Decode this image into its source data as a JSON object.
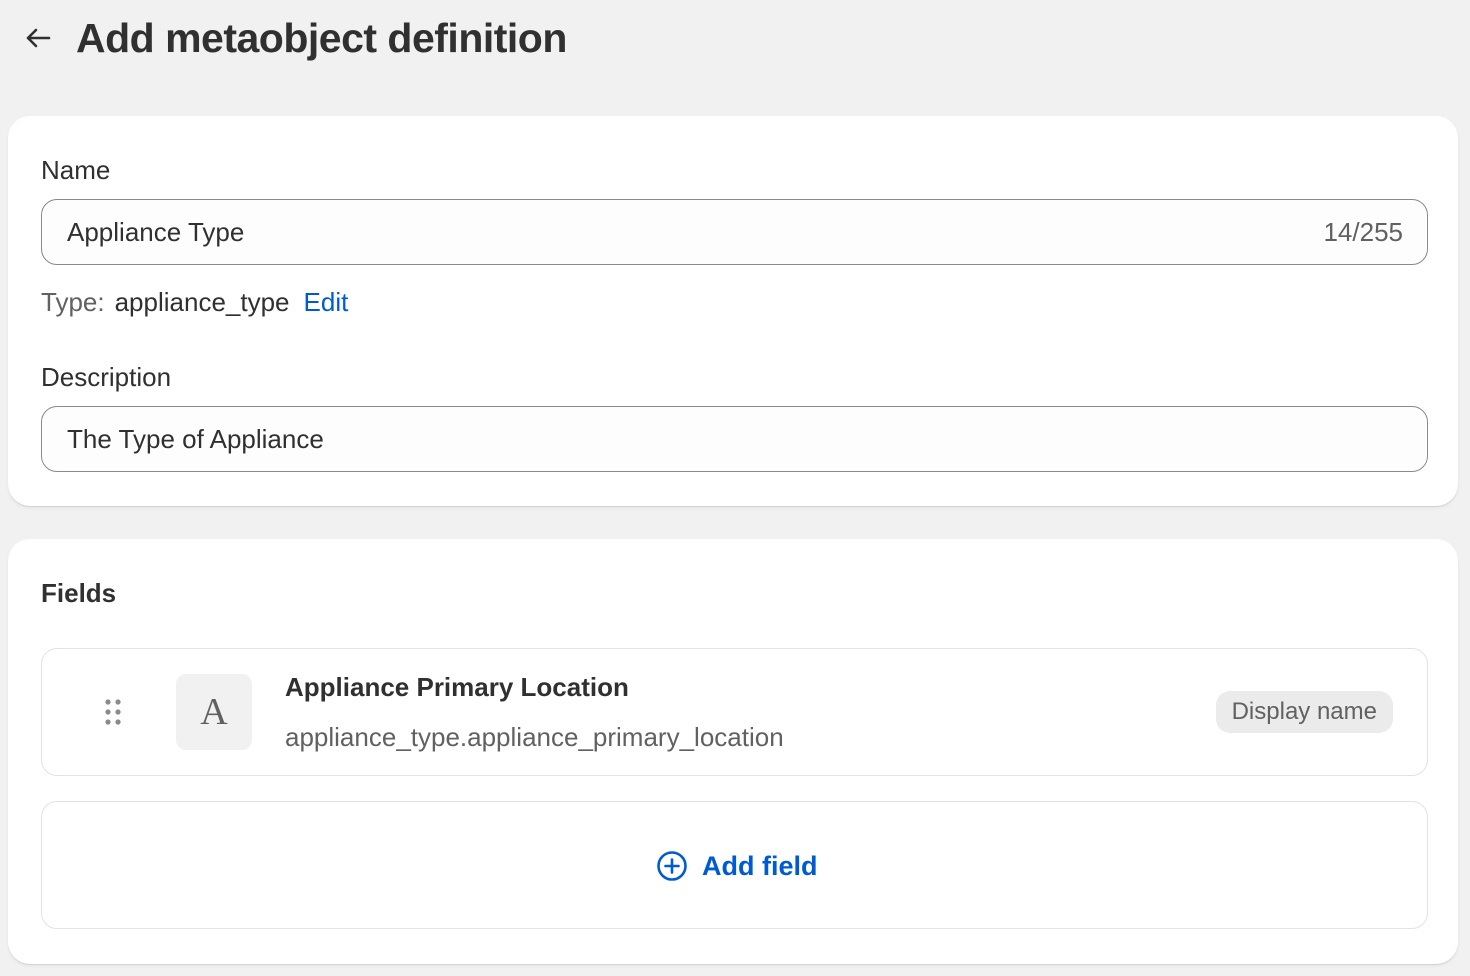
{
  "header": {
    "back_icon": "arrow-left-icon",
    "title": "Add metaobject definition"
  },
  "general": {
    "name_label": "Name",
    "name_value": "Appliance Type",
    "name_count": "14/255",
    "type_label": "Type:",
    "type_value": "appliance_type",
    "type_edit": "Edit",
    "description_label": "Description",
    "description_value": "The Type of Appliance"
  },
  "fields": {
    "heading": "Fields",
    "items": [
      {
        "type_icon": "text-type-icon",
        "type_glyph": "A",
        "title": "Appliance Primary Location",
        "key": "appliance_type.appliance_primary_location",
        "badge": "Display name"
      }
    ],
    "add_icon": "plus-circle-icon",
    "add_label": "Add field"
  },
  "colors": {
    "accent": "#005bd3",
    "background": "#f1f1f1",
    "card": "#ffffff",
    "text": "#303030",
    "subdued": "#616161"
  }
}
